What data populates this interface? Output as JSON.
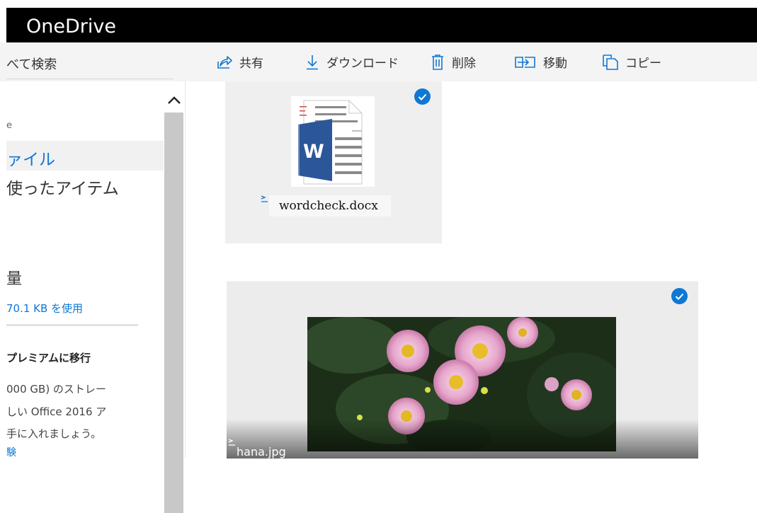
{
  "app": {
    "title": "OneDrive"
  },
  "search": {
    "text": "べて検索"
  },
  "commands": [
    {
      "label": "共有",
      "icon": "share-icon"
    },
    {
      "label": "ダウンロード",
      "icon": "download-icon"
    },
    {
      "label": "削除",
      "icon": "trash-icon"
    },
    {
      "label": "移動",
      "icon": "move-icon"
    },
    {
      "label": "コピー",
      "icon": "copy-icon"
    }
  ],
  "nav": {
    "partial_item": "e",
    "files": "ァイル",
    "recent": "使ったアイテム",
    "storage_heading": "量",
    "storage_used": "70.1 KB を使用",
    "premium_heading": "プレミアムに移行",
    "promo_lines": [
      "000 GB) のストレー",
      "しい Office 2016 ア",
      "手に入れましょう。"
    ],
    "promo_link": "験"
  },
  "files": [
    {
      "name": "wordcheck.docx",
      "type": "word-document",
      "selected": true
    },
    {
      "name": "hana.jpg",
      "type": "image",
      "selected": true
    }
  ],
  "colors": {
    "accent": "#0f78d4",
    "header": "#000000",
    "word_blue": "#2b579a"
  }
}
